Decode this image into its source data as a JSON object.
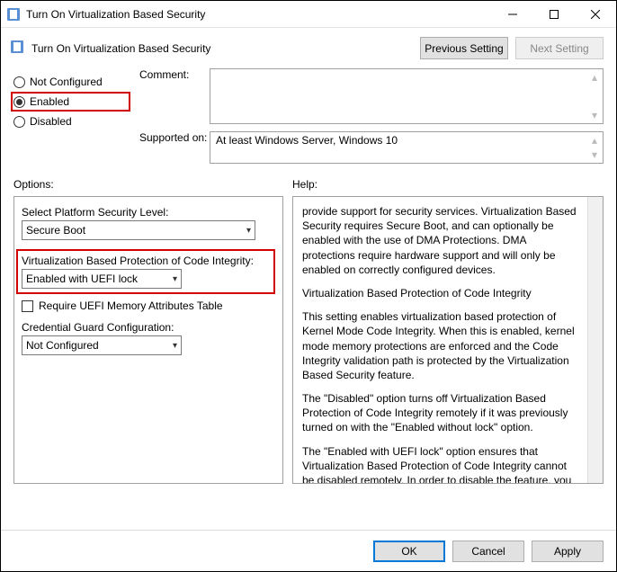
{
  "window": {
    "title": "Turn On Virtualization Based Security"
  },
  "header": {
    "policy_title": "Turn On Virtualization Based Security",
    "prev_setting": "Previous Setting",
    "next_setting": "Next Setting"
  },
  "state": {
    "not_configured": "Not Configured",
    "enabled": "Enabled",
    "disabled": "Disabled",
    "selected": "enabled"
  },
  "fields": {
    "comment_label": "Comment:",
    "supported_label": "Supported on:",
    "supported_value": "At least Windows Server, Windows 10"
  },
  "sections": {
    "options_label": "Options:",
    "help_label": "Help:"
  },
  "options": {
    "platform_label": "Select Platform Security Level:",
    "platform_value": "Secure Boot",
    "vbpci_label": "Virtualization Based Protection of Code Integrity:",
    "vbpci_value": "Enabled with UEFI lock",
    "uefi_mem_label": "Require UEFI Memory Attributes Table",
    "cred_guard_label": "Credential Guard Configuration:",
    "cred_guard_value": "Not Configured"
  },
  "help": {
    "p1": "provide support for security services. Virtualization Based Security requires Secure Boot, and can optionally be enabled with the use of DMA Protections. DMA protections require hardware support and will only be enabled on correctly configured devices.",
    "p2": "Virtualization Based Protection of Code Integrity",
    "p3": "This setting enables virtualization based protection of Kernel Mode Code Integrity. When this is enabled, kernel mode memory protections are enforced and the Code Integrity validation path is protected by the Virtualization Based Security feature.",
    "p4": "The \"Disabled\" option turns off Virtualization Based Protection of Code Integrity remotely if it was previously turned on with the \"Enabled without lock\" option.",
    "p5": "The \"Enabled with UEFI lock\" option ensures that Virtualization Based Protection of Code Integrity cannot be disabled remotely. In order to disable the feature, you must set the Group Policy to"
  },
  "footer": {
    "ok": "OK",
    "cancel": "Cancel",
    "apply": "Apply"
  }
}
